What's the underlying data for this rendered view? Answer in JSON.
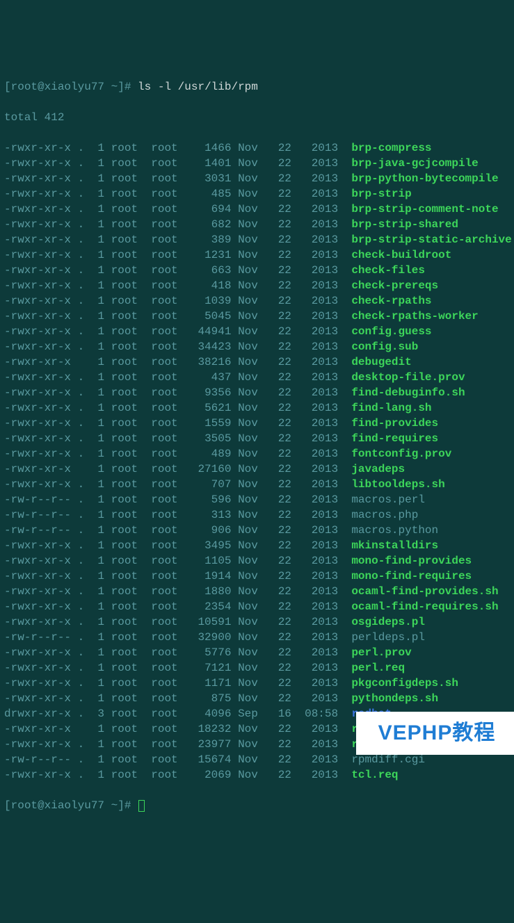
{
  "prompt": {
    "open": "[",
    "user_host": "root@xiaolyu77 ~",
    "close": "]#",
    "command": "ls -l /usr/lib/rpm"
  },
  "total_line": "total 412",
  "rows": [
    {
      "perms": "-rwxr-xr-x",
      "dot": ".",
      "links": "1",
      "owner": "root",
      "group": "root",
      "size": "1466",
      "month": "Nov",
      "day": "22",
      "yeartime": "2013",
      "name": "brp-compress",
      "kind": "exec"
    },
    {
      "perms": "-rwxr-xr-x",
      "dot": ".",
      "links": "1",
      "owner": "root",
      "group": "root",
      "size": "1401",
      "month": "Nov",
      "day": "22",
      "yeartime": "2013",
      "name": "brp-java-gcjcompile",
      "kind": "exec"
    },
    {
      "perms": "-rwxr-xr-x",
      "dot": ".",
      "links": "1",
      "owner": "root",
      "group": "root",
      "size": "3031",
      "month": "Nov",
      "day": "22",
      "yeartime": "2013",
      "name": "brp-python-bytecompile",
      "kind": "exec"
    },
    {
      "perms": "-rwxr-xr-x",
      "dot": ".",
      "links": "1",
      "owner": "root",
      "group": "root",
      "size": "485",
      "month": "Nov",
      "day": "22",
      "yeartime": "2013",
      "name": "brp-strip",
      "kind": "exec"
    },
    {
      "perms": "-rwxr-xr-x",
      "dot": ".",
      "links": "1",
      "owner": "root",
      "group": "root",
      "size": "694",
      "month": "Nov",
      "day": "22",
      "yeartime": "2013",
      "name": "brp-strip-comment-note",
      "kind": "exec"
    },
    {
      "perms": "-rwxr-xr-x",
      "dot": ".",
      "links": "1",
      "owner": "root",
      "group": "root",
      "size": "682",
      "month": "Nov",
      "day": "22",
      "yeartime": "2013",
      "name": "brp-strip-shared",
      "kind": "exec"
    },
    {
      "perms": "-rwxr-xr-x",
      "dot": ".",
      "links": "1",
      "owner": "root",
      "group": "root",
      "size": "389",
      "month": "Nov",
      "day": "22",
      "yeartime": "2013",
      "name": "brp-strip-static-archive",
      "kind": "exec"
    },
    {
      "perms": "-rwxr-xr-x",
      "dot": ".",
      "links": "1",
      "owner": "root",
      "group": "root",
      "size": "1231",
      "month": "Nov",
      "day": "22",
      "yeartime": "2013",
      "name": "check-buildroot",
      "kind": "exec"
    },
    {
      "perms": "-rwxr-xr-x",
      "dot": ".",
      "links": "1",
      "owner": "root",
      "group": "root",
      "size": "663",
      "month": "Nov",
      "day": "22",
      "yeartime": "2013",
      "name": "check-files",
      "kind": "exec"
    },
    {
      "perms": "-rwxr-xr-x",
      "dot": ".",
      "links": "1",
      "owner": "root",
      "group": "root",
      "size": "418",
      "month": "Nov",
      "day": "22",
      "yeartime": "2013",
      "name": "check-prereqs",
      "kind": "exec"
    },
    {
      "perms": "-rwxr-xr-x",
      "dot": ".",
      "links": "1",
      "owner": "root",
      "group": "root",
      "size": "1039",
      "month": "Nov",
      "day": "22",
      "yeartime": "2013",
      "name": "check-rpaths",
      "kind": "exec"
    },
    {
      "perms": "-rwxr-xr-x",
      "dot": ".",
      "links": "1",
      "owner": "root",
      "group": "root",
      "size": "5045",
      "month": "Nov",
      "day": "22",
      "yeartime": "2013",
      "name": "check-rpaths-worker",
      "kind": "exec"
    },
    {
      "perms": "-rwxr-xr-x",
      "dot": ".",
      "links": "1",
      "owner": "root",
      "group": "root",
      "size": "44941",
      "month": "Nov",
      "day": "22",
      "yeartime": "2013",
      "name": "config.guess",
      "kind": "exec"
    },
    {
      "perms": "-rwxr-xr-x",
      "dot": ".",
      "links": "1",
      "owner": "root",
      "group": "root",
      "size": "34423",
      "month": "Nov",
      "day": "22",
      "yeartime": "2013",
      "name": "config.sub",
      "kind": "exec"
    },
    {
      "perms": "-rwxr-xr-x",
      "dot": " ",
      "links": "1",
      "owner": "root",
      "group": "root",
      "size": "38216",
      "month": "Nov",
      "day": "22",
      "yeartime": "2013",
      "name": "debugedit",
      "kind": "exec"
    },
    {
      "perms": "-rwxr-xr-x",
      "dot": ".",
      "links": "1",
      "owner": "root",
      "group": "root",
      "size": "437",
      "month": "Nov",
      "day": "22",
      "yeartime": "2013",
      "name": "desktop-file.prov",
      "kind": "exec"
    },
    {
      "perms": "-rwxr-xr-x",
      "dot": ".",
      "links": "1",
      "owner": "root",
      "group": "root",
      "size": "9356",
      "month": "Nov",
      "day": "22",
      "yeartime": "2013",
      "name": "find-debuginfo.sh",
      "kind": "exec"
    },
    {
      "perms": "-rwxr-xr-x",
      "dot": ".",
      "links": "1",
      "owner": "root",
      "group": "root",
      "size": "5621",
      "month": "Nov",
      "day": "22",
      "yeartime": "2013",
      "name": "find-lang.sh",
      "kind": "exec"
    },
    {
      "perms": "-rwxr-xr-x",
      "dot": ".",
      "links": "1",
      "owner": "root",
      "group": "root",
      "size": "1559",
      "month": "Nov",
      "day": "22",
      "yeartime": "2013",
      "name": "find-provides",
      "kind": "exec"
    },
    {
      "perms": "-rwxr-xr-x",
      "dot": ".",
      "links": "1",
      "owner": "root",
      "group": "root",
      "size": "3505",
      "month": "Nov",
      "day": "22",
      "yeartime": "2013",
      "name": "find-requires",
      "kind": "exec"
    },
    {
      "perms": "-rwxr-xr-x",
      "dot": ".",
      "links": "1",
      "owner": "root",
      "group": "root",
      "size": "489",
      "month": "Nov",
      "day": "22",
      "yeartime": "2013",
      "name": "fontconfig.prov",
      "kind": "exec"
    },
    {
      "perms": "-rwxr-xr-x",
      "dot": " ",
      "links": "1",
      "owner": "root",
      "group": "root",
      "size": "27160",
      "month": "Nov",
      "day": "22",
      "yeartime": "2013",
      "name": "javadeps",
      "kind": "exec"
    },
    {
      "perms": "-rwxr-xr-x",
      "dot": ".",
      "links": "1",
      "owner": "root",
      "group": "root",
      "size": "707",
      "month": "Nov",
      "day": "22",
      "yeartime": "2013",
      "name": "libtooldeps.sh",
      "kind": "exec"
    },
    {
      "perms": "-rw-r--r--",
      "dot": ".",
      "links": "1",
      "owner": "root",
      "group": "root",
      "size": "596",
      "month": "Nov",
      "day": "22",
      "yeartime": "2013",
      "name": "macros.perl",
      "kind": "reg"
    },
    {
      "perms": "-rw-r--r--",
      "dot": ".",
      "links": "1",
      "owner": "root",
      "group": "root",
      "size": "313",
      "month": "Nov",
      "day": "22",
      "yeartime": "2013",
      "name": "macros.php",
      "kind": "reg"
    },
    {
      "perms": "-rw-r--r--",
      "dot": ".",
      "links": "1",
      "owner": "root",
      "group": "root",
      "size": "906",
      "month": "Nov",
      "day": "22",
      "yeartime": "2013",
      "name": "macros.python",
      "kind": "reg"
    },
    {
      "perms": "-rwxr-xr-x",
      "dot": ".",
      "links": "1",
      "owner": "root",
      "group": "root",
      "size": "3495",
      "month": "Nov",
      "day": "22",
      "yeartime": "2013",
      "name": "mkinstalldirs",
      "kind": "exec"
    },
    {
      "perms": "-rwxr-xr-x",
      "dot": ".",
      "links": "1",
      "owner": "root",
      "group": "root",
      "size": "1105",
      "month": "Nov",
      "day": "22",
      "yeartime": "2013",
      "name": "mono-find-provides",
      "kind": "exec"
    },
    {
      "perms": "-rwxr-xr-x",
      "dot": ".",
      "links": "1",
      "owner": "root",
      "group": "root",
      "size": "1914",
      "month": "Nov",
      "day": "22",
      "yeartime": "2013",
      "name": "mono-find-requires",
      "kind": "exec"
    },
    {
      "perms": "-rwxr-xr-x",
      "dot": ".",
      "links": "1",
      "owner": "root",
      "group": "root",
      "size": "1880",
      "month": "Nov",
      "day": "22",
      "yeartime": "2013",
      "name": "ocaml-find-provides.sh",
      "kind": "exec"
    },
    {
      "perms": "-rwxr-xr-x",
      "dot": ".",
      "links": "1",
      "owner": "root",
      "group": "root",
      "size": "2354",
      "month": "Nov",
      "day": "22",
      "yeartime": "2013",
      "name": "ocaml-find-requires.sh",
      "kind": "exec"
    },
    {
      "perms": "-rwxr-xr-x",
      "dot": ".",
      "links": "1",
      "owner": "root",
      "group": "root",
      "size": "10591",
      "month": "Nov",
      "day": "22",
      "yeartime": "2013",
      "name": "osgideps.pl",
      "kind": "exec"
    },
    {
      "perms": "-rw-r--r--",
      "dot": ".",
      "links": "1",
      "owner": "root",
      "group": "root",
      "size": "32900",
      "month": "Nov",
      "day": "22",
      "yeartime": "2013",
      "name": "perldeps.pl",
      "kind": "reg"
    },
    {
      "perms": "-rwxr-xr-x",
      "dot": ".",
      "links": "1",
      "owner": "root",
      "group": "root",
      "size": "5776",
      "month": "Nov",
      "day": "22",
      "yeartime": "2013",
      "name": "perl.prov",
      "kind": "exec"
    },
    {
      "perms": "-rwxr-xr-x",
      "dot": ".",
      "links": "1",
      "owner": "root",
      "group": "root",
      "size": "7121",
      "month": "Nov",
      "day": "22",
      "yeartime": "2013",
      "name": "perl.req",
      "kind": "exec"
    },
    {
      "perms": "-rwxr-xr-x",
      "dot": ".",
      "links": "1",
      "owner": "root",
      "group": "root",
      "size": "1171",
      "month": "Nov",
      "day": "22",
      "yeartime": "2013",
      "name": "pkgconfigdeps.sh",
      "kind": "exec"
    },
    {
      "perms": "-rwxr-xr-x",
      "dot": ".",
      "links": "1",
      "owner": "root",
      "group": "root",
      "size": "875",
      "month": "Nov",
      "day": "22",
      "yeartime": "2013",
      "name": "pythondeps.sh",
      "kind": "exec"
    },
    {
      "perms": "drwxr-xr-x",
      "dot": ".",
      "links": "3",
      "owner": "root",
      "group": "root",
      "size": "4096",
      "month": "Sep",
      "day": "16",
      "yeartime": "08:58",
      "name": "redhat",
      "kind": "dir"
    },
    {
      "perms": "-rwxr-xr-x",
      "dot": " ",
      "links": "1",
      "owner": "root",
      "group": "root",
      "size": "18232",
      "month": "Nov",
      "day": "22",
      "yeartime": "2013",
      "name": "rpmdeps",
      "kind": "exec"
    },
    {
      "perms": "-rwxr-xr-x",
      "dot": ".",
      "links": "1",
      "owner": "root",
      "group": "root",
      "size": "23977",
      "month": "Nov",
      "day": "22",
      "yeartime": "2013",
      "name": "rpmdiff",
      "kind": "exec"
    },
    {
      "perms": "-rw-r--r--",
      "dot": ".",
      "links": "1",
      "owner": "root",
      "group": "root",
      "size": "15674",
      "month": "Nov",
      "day": "22",
      "yeartime": "2013",
      "name": "rpmdiff.cgi",
      "kind": "reg"
    },
    {
      "perms": "-rwxr-xr-x",
      "dot": ".",
      "links": "1",
      "owner": "root",
      "group": "root",
      "size": "2069",
      "month": "Nov",
      "day": "22",
      "yeartime": "2013",
      "name": "tcl.req",
      "kind": "exec"
    }
  ],
  "prompt2": {
    "open": "[",
    "user_host": "root@xiaolyu77 ~",
    "close": "]#"
  },
  "watermark": "VEPHP教程"
}
